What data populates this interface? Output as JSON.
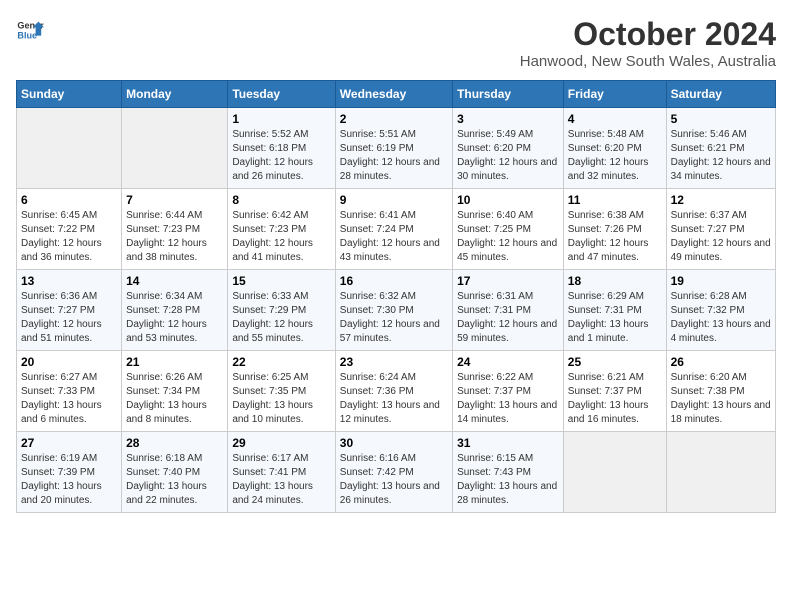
{
  "header": {
    "logo_line1": "General",
    "logo_line2": "Blue",
    "title": "October 2024",
    "subtitle": "Hanwood, New South Wales, Australia"
  },
  "weekdays": [
    "Sunday",
    "Monday",
    "Tuesday",
    "Wednesday",
    "Thursday",
    "Friday",
    "Saturday"
  ],
  "weeks": [
    [
      {
        "day": "",
        "sunrise": "",
        "sunset": "",
        "daylight": "",
        "empty": true
      },
      {
        "day": "",
        "sunrise": "",
        "sunset": "",
        "daylight": "",
        "empty": true
      },
      {
        "day": "1",
        "sunrise": "Sunrise: 5:52 AM",
        "sunset": "Sunset: 6:18 PM",
        "daylight": "Daylight: 12 hours and 26 minutes."
      },
      {
        "day": "2",
        "sunrise": "Sunrise: 5:51 AM",
        "sunset": "Sunset: 6:19 PM",
        "daylight": "Daylight: 12 hours and 28 minutes."
      },
      {
        "day": "3",
        "sunrise": "Sunrise: 5:49 AM",
        "sunset": "Sunset: 6:20 PM",
        "daylight": "Daylight: 12 hours and 30 minutes."
      },
      {
        "day": "4",
        "sunrise": "Sunrise: 5:48 AM",
        "sunset": "Sunset: 6:20 PM",
        "daylight": "Daylight: 12 hours and 32 minutes."
      },
      {
        "day": "5",
        "sunrise": "Sunrise: 5:46 AM",
        "sunset": "Sunset: 6:21 PM",
        "daylight": "Daylight: 12 hours and 34 minutes."
      }
    ],
    [
      {
        "day": "6",
        "sunrise": "Sunrise: 6:45 AM",
        "sunset": "Sunset: 7:22 PM",
        "daylight": "Daylight: 12 hours and 36 minutes."
      },
      {
        "day": "7",
        "sunrise": "Sunrise: 6:44 AM",
        "sunset": "Sunset: 7:23 PM",
        "daylight": "Daylight: 12 hours and 38 minutes."
      },
      {
        "day": "8",
        "sunrise": "Sunrise: 6:42 AM",
        "sunset": "Sunset: 7:23 PM",
        "daylight": "Daylight: 12 hours and 41 minutes."
      },
      {
        "day": "9",
        "sunrise": "Sunrise: 6:41 AM",
        "sunset": "Sunset: 7:24 PM",
        "daylight": "Daylight: 12 hours and 43 minutes."
      },
      {
        "day": "10",
        "sunrise": "Sunrise: 6:40 AM",
        "sunset": "Sunset: 7:25 PM",
        "daylight": "Daylight: 12 hours and 45 minutes."
      },
      {
        "day": "11",
        "sunrise": "Sunrise: 6:38 AM",
        "sunset": "Sunset: 7:26 PM",
        "daylight": "Daylight: 12 hours and 47 minutes."
      },
      {
        "day": "12",
        "sunrise": "Sunrise: 6:37 AM",
        "sunset": "Sunset: 7:27 PM",
        "daylight": "Daylight: 12 hours and 49 minutes."
      }
    ],
    [
      {
        "day": "13",
        "sunrise": "Sunrise: 6:36 AM",
        "sunset": "Sunset: 7:27 PM",
        "daylight": "Daylight: 12 hours and 51 minutes."
      },
      {
        "day": "14",
        "sunrise": "Sunrise: 6:34 AM",
        "sunset": "Sunset: 7:28 PM",
        "daylight": "Daylight: 12 hours and 53 minutes."
      },
      {
        "day": "15",
        "sunrise": "Sunrise: 6:33 AM",
        "sunset": "Sunset: 7:29 PM",
        "daylight": "Daylight: 12 hours and 55 minutes."
      },
      {
        "day": "16",
        "sunrise": "Sunrise: 6:32 AM",
        "sunset": "Sunset: 7:30 PM",
        "daylight": "Daylight: 12 hours and 57 minutes."
      },
      {
        "day": "17",
        "sunrise": "Sunrise: 6:31 AM",
        "sunset": "Sunset: 7:31 PM",
        "daylight": "Daylight: 12 hours and 59 minutes."
      },
      {
        "day": "18",
        "sunrise": "Sunrise: 6:29 AM",
        "sunset": "Sunset: 7:31 PM",
        "daylight": "Daylight: 13 hours and 1 minute."
      },
      {
        "day": "19",
        "sunrise": "Sunrise: 6:28 AM",
        "sunset": "Sunset: 7:32 PM",
        "daylight": "Daylight: 13 hours and 4 minutes."
      }
    ],
    [
      {
        "day": "20",
        "sunrise": "Sunrise: 6:27 AM",
        "sunset": "Sunset: 7:33 PM",
        "daylight": "Daylight: 13 hours and 6 minutes."
      },
      {
        "day": "21",
        "sunrise": "Sunrise: 6:26 AM",
        "sunset": "Sunset: 7:34 PM",
        "daylight": "Daylight: 13 hours and 8 minutes."
      },
      {
        "day": "22",
        "sunrise": "Sunrise: 6:25 AM",
        "sunset": "Sunset: 7:35 PM",
        "daylight": "Daylight: 13 hours and 10 minutes."
      },
      {
        "day": "23",
        "sunrise": "Sunrise: 6:24 AM",
        "sunset": "Sunset: 7:36 PM",
        "daylight": "Daylight: 13 hours and 12 minutes."
      },
      {
        "day": "24",
        "sunrise": "Sunrise: 6:22 AM",
        "sunset": "Sunset: 7:37 PM",
        "daylight": "Daylight: 13 hours and 14 minutes."
      },
      {
        "day": "25",
        "sunrise": "Sunrise: 6:21 AM",
        "sunset": "Sunset: 7:37 PM",
        "daylight": "Daylight: 13 hours and 16 minutes."
      },
      {
        "day": "26",
        "sunrise": "Sunrise: 6:20 AM",
        "sunset": "Sunset: 7:38 PM",
        "daylight": "Daylight: 13 hours and 18 minutes."
      }
    ],
    [
      {
        "day": "27",
        "sunrise": "Sunrise: 6:19 AM",
        "sunset": "Sunset: 7:39 PM",
        "daylight": "Daylight: 13 hours and 20 minutes."
      },
      {
        "day": "28",
        "sunrise": "Sunrise: 6:18 AM",
        "sunset": "Sunset: 7:40 PM",
        "daylight": "Daylight: 13 hours and 22 minutes."
      },
      {
        "day": "29",
        "sunrise": "Sunrise: 6:17 AM",
        "sunset": "Sunset: 7:41 PM",
        "daylight": "Daylight: 13 hours and 24 minutes."
      },
      {
        "day": "30",
        "sunrise": "Sunrise: 6:16 AM",
        "sunset": "Sunset: 7:42 PM",
        "daylight": "Daylight: 13 hours and 26 minutes."
      },
      {
        "day": "31",
        "sunrise": "Sunrise: 6:15 AM",
        "sunset": "Sunset: 7:43 PM",
        "daylight": "Daylight: 13 hours and 28 minutes."
      },
      {
        "day": "",
        "sunrise": "",
        "sunset": "",
        "daylight": "",
        "empty": true
      },
      {
        "day": "",
        "sunrise": "",
        "sunset": "",
        "daylight": "",
        "empty": true
      }
    ]
  ]
}
